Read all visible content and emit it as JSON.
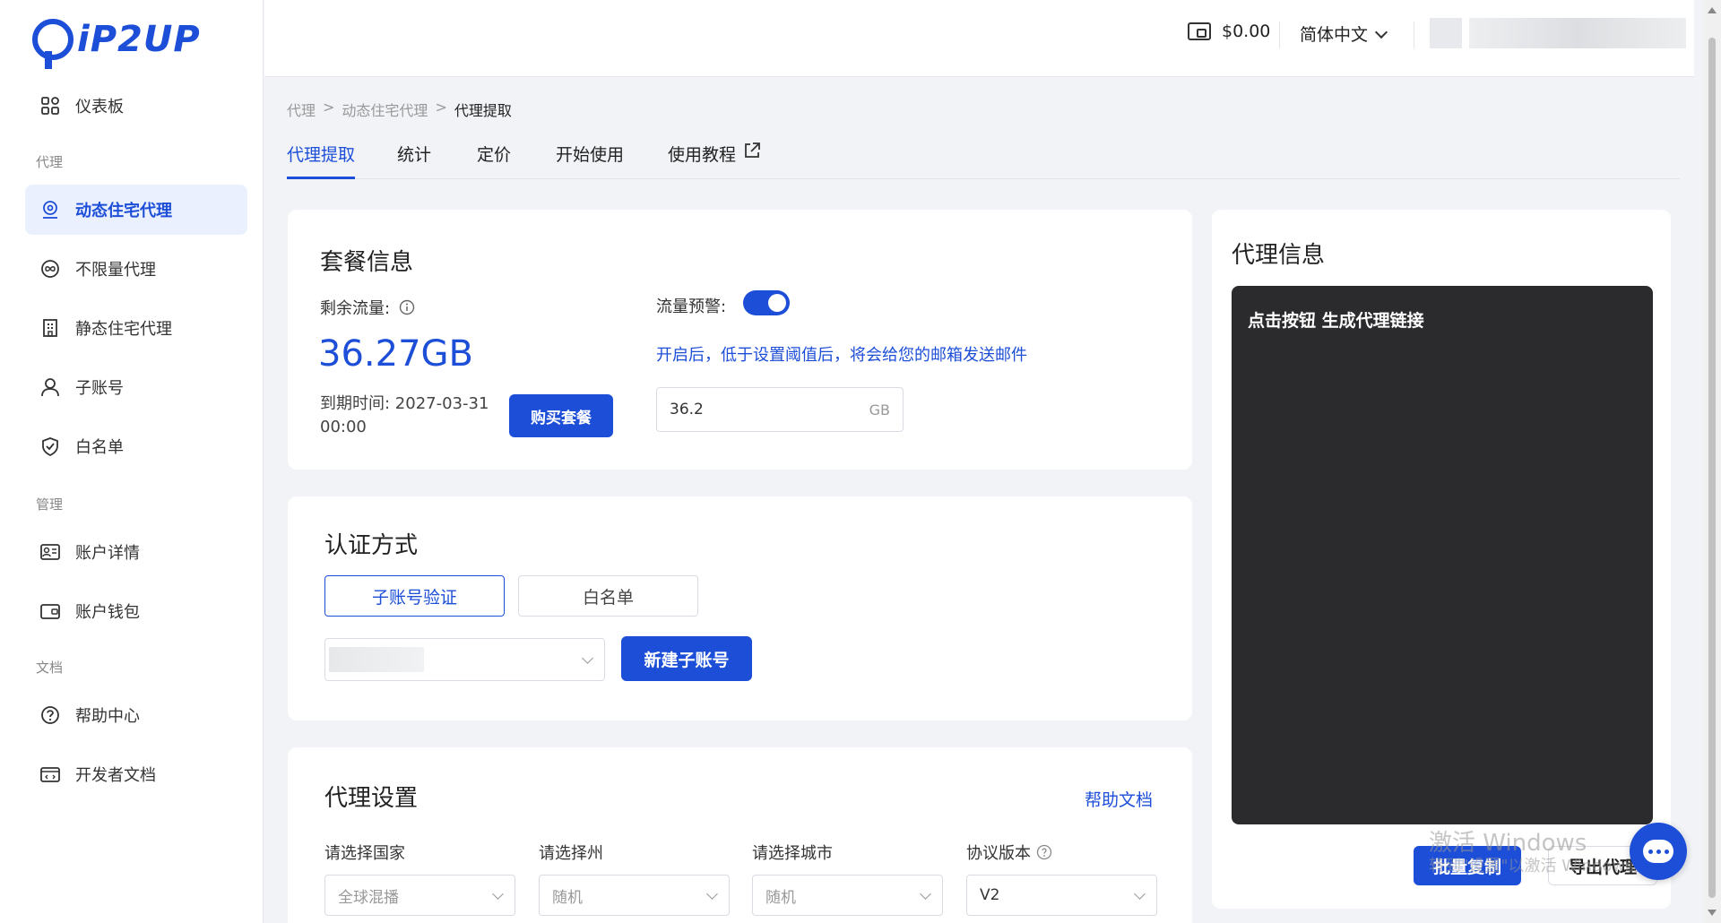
{
  "logo": {
    "text": "iP2UP"
  },
  "sidebar": {
    "dashboard": "仪表板",
    "section_proxy": "代理",
    "items_proxy": [
      "动态住宅代理",
      "不限量代理",
      "静态住宅代理",
      "子账号",
      "白名单"
    ],
    "section_manage": "管理",
    "items_manage": [
      "账户详情",
      "账户钱包"
    ],
    "section_docs": "文档",
    "items_docs": [
      "帮助中心",
      "开发者文档"
    ],
    "active": "动态住宅代理"
  },
  "header": {
    "balance": "$0.00",
    "language": "简体中文"
  },
  "breadcrumb": {
    "a": "代理",
    "b": "动态住宅代理",
    "c": "代理提取",
    "sep": ">"
  },
  "tabs": [
    "代理提取",
    "统计",
    "定价",
    "开始使用",
    "使用教程"
  ],
  "package": {
    "title": "套餐信息",
    "remaining_label": "剩余流量:",
    "remaining_value": "36.27GB",
    "expiry_label": "到期时间: 2027-03-31",
    "expiry_time": "00:00",
    "buy_button": "购买套餐",
    "alert_label": "流量预警:",
    "alert_enabled": true,
    "alert_note": "开启后，低于设置阈值后，将会给您的邮箱发送邮件",
    "threshold_value": "36.2",
    "threshold_unit": "GB"
  },
  "auth": {
    "title": "认证方式",
    "option_subaccount": "子账号验证",
    "option_whitelist": "白名单",
    "selected": "子账号验证",
    "new_subaccount_button": "新建子账号"
  },
  "settings": {
    "title": "代理设置",
    "help_link": "帮助文档",
    "country_label": "请选择国家",
    "country_value": "全球混播",
    "state_label": "请选择州",
    "state_value": "随机",
    "city_label": "请选择城市",
    "city_value": "随机",
    "protocol_label": "协议版本",
    "protocol_value": "V2"
  },
  "proxy_info": {
    "title": "代理信息",
    "placeholder": "点击按钮 生成代理链接",
    "batch_copy": "批量复制",
    "export": "导出代理"
  },
  "watermark": {
    "line1": "激活 Windows",
    "line2": "转到\"设置\"以激活 Windows。"
  },
  "colors": {
    "accent": "#1d4ed8",
    "terminal_bg": "#2b2b2d"
  }
}
